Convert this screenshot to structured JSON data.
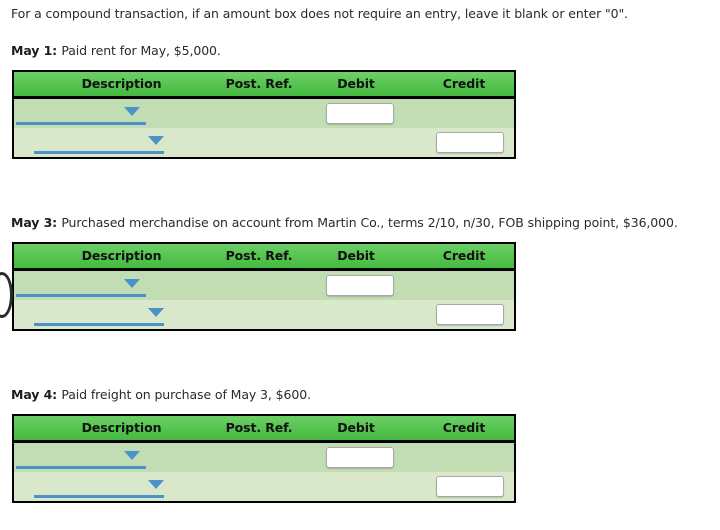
{
  "instruction": "For a compound transaction, if an amount box does not require an entry, leave it blank or enter \"0\".",
  "columns": {
    "description": "Description",
    "post_ref": "Post. Ref.",
    "debit": "Debit",
    "credit": "Credit"
  },
  "colors": {
    "header_green_light": "#6ecf68",
    "header_green_dark": "#46ba41",
    "row_a": "#c2ddb3",
    "row_b": "#d9e8cb",
    "control_blue": "#4a92c8",
    "border_black": "#000000",
    "input_border": "#a8a8a8"
  },
  "transactions": [
    {
      "date_label": "May 1:",
      "description": "Paid rent for May, $5,000.",
      "rows": [
        {
          "account_value": "",
          "account_placeholder": "",
          "post_ref": "",
          "debit_value": "",
          "credit_value": "",
          "amount_field": "debit"
        },
        {
          "account_value": "",
          "account_placeholder": "",
          "post_ref": "",
          "debit_value": "",
          "credit_value": "",
          "amount_field": "credit"
        }
      ]
    },
    {
      "date_label": "May 3:",
      "description": "Purchased merchandise on account from Martin Co., terms 2/10, n/30, FOB shipping point, $36,000.",
      "rows": [
        {
          "account_value": "",
          "account_placeholder": "",
          "post_ref": "",
          "debit_value": "",
          "credit_value": "",
          "amount_field": "debit"
        },
        {
          "account_value": "",
          "account_placeholder": "",
          "post_ref": "",
          "debit_value": "",
          "credit_value": "",
          "amount_field": "credit"
        }
      ]
    },
    {
      "date_label": "May 4:",
      "description": "Paid freight on purchase of May 3, $600.",
      "rows": [
        {
          "account_value": "",
          "account_placeholder": "",
          "post_ref": "",
          "debit_value": "",
          "credit_value": "",
          "amount_field": "debit"
        },
        {
          "account_value": "",
          "account_placeholder": "",
          "post_ref": "",
          "debit_value": "",
          "credit_value": "",
          "amount_field": "credit"
        }
      ]
    }
  ],
  "layout": {
    "table_tops": [
      70,
      242,
      414
    ],
    "txn_text_tops": [
      43,
      215,
      387
    ]
  }
}
